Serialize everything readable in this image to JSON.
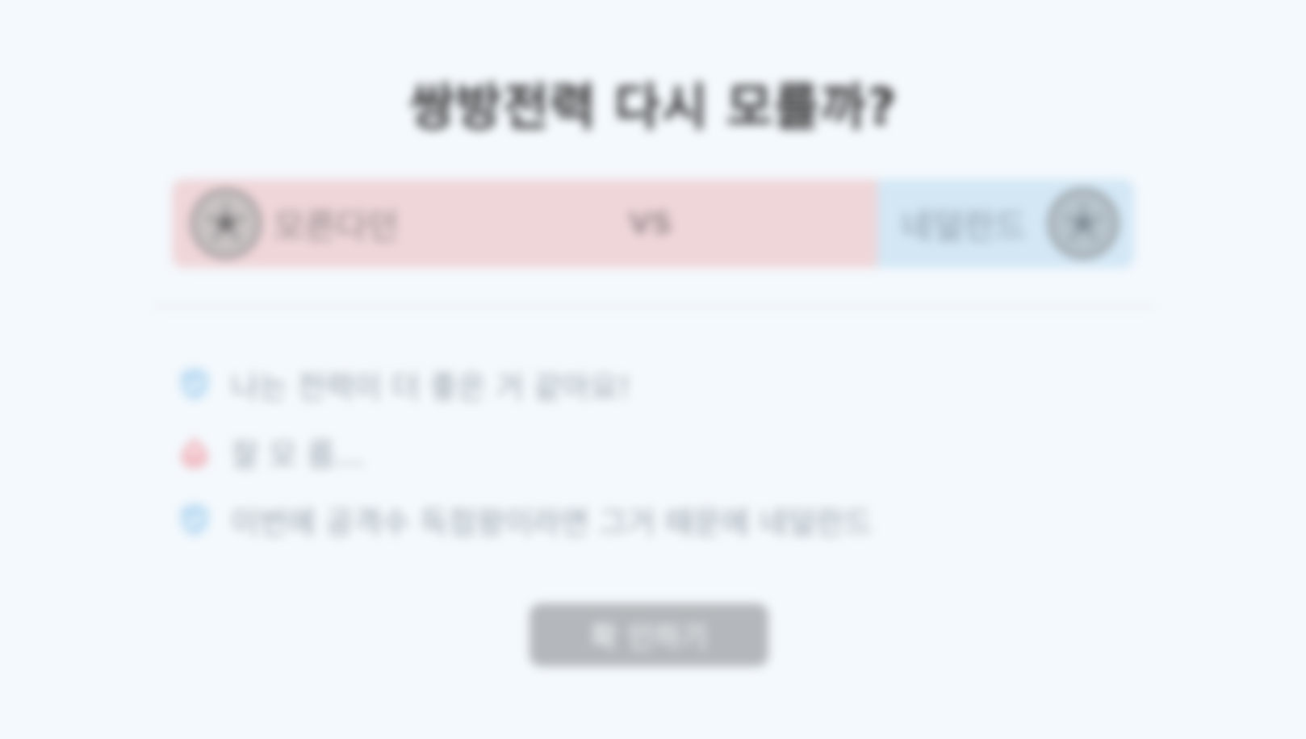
{
  "title": "쌍방전력 다시 모를까?",
  "matchup": {
    "left_team": "모른다던",
    "vs": "VS",
    "right_team": "네덜란드"
  },
  "items": [
    {
      "label": "나는 전력이 더 좋은 거 같아요!",
      "icon": "check-shield-icon",
      "color": "#bcdcf2"
    },
    {
      "label": "잘 모 름...",
      "icon": "flag-icon",
      "color": "#efb8c0"
    },
    {
      "label": "이번에 공격수 득점왕이라면 그거 때문에 네덜란드",
      "icon": "check-shield-icon",
      "color": "#bcdcf2"
    }
  ],
  "confirm_button": "확 인하기",
  "colors": {
    "background": "#f4f9fd",
    "left_panel": "#efd6d9",
    "right_panel": "#d3e7f5",
    "button": "#b4b8bc"
  }
}
